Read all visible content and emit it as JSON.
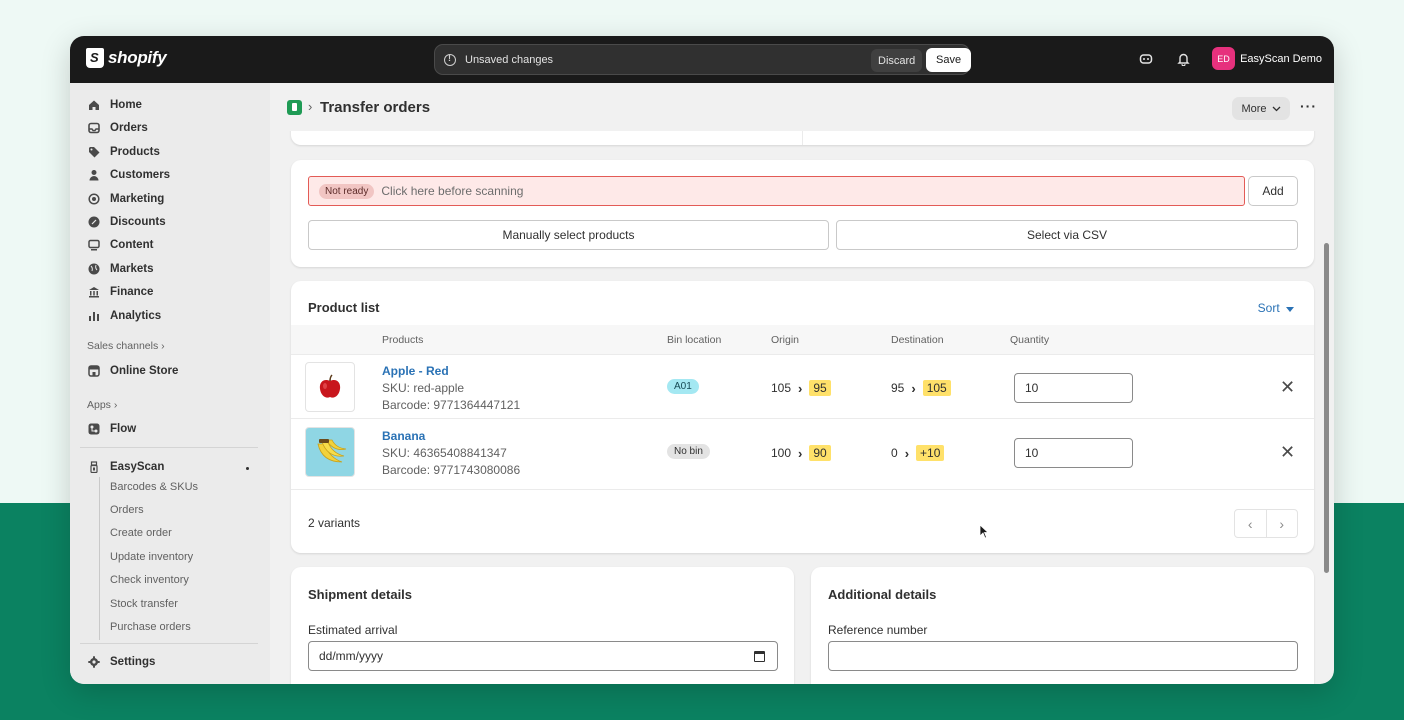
{
  "topbar": {
    "brand": "shopify",
    "unsaved_text": "Unsaved changes",
    "discard_label": "Discard",
    "save_label": "Save",
    "avatar_initials": "ED",
    "store_name": "EasyScan Demo"
  },
  "sidebar": {
    "items": [
      {
        "label": "Home",
        "icon": "home-icon"
      },
      {
        "label": "Orders",
        "icon": "orders-icon"
      },
      {
        "label": "Products",
        "icon": "tag-icon"
      },
      {
        "label": "Customers",
        "icon": "person-icon"
      },
      {
        "label": "Marketing",
        "icon": "target-icon"
      },
      {
        "label": "Discounts",
        "icon": "discount-icon"
      },
      {
        "label": "Content",
        "icon": "content-icon"
      },
      {
        "label": "Markets",
        "icon": "globe-icon"
      },
      {
        "label": "Finance",
        "icon": "bank-icon"
      },
      {
        "label": "Analytics",
        "icon": "bar-chart-icon"
      }
    ],
    "sales_channels_title": "Sales channels",
    "online_store": "Online Store",
    "apps_title": "Apps",
    "flow": "Flow",
    "easyscan": "EasyScan",
    "easyscan_subitems": [
      "Barcodes & SKUs",
      "Orders",
      "Create order",
      "Update inventory",
      "Check inventory",
      "Stock transfer",
      "Purchase orders"
    ],
    "settings": "Settings"
  },
  "header": {
    "title": "Transfer orders",
    "more_label": "More"
  },
  "scanner": {
    "status_badge": "Not ready",
    "placeholder": "Click here before scanning",
    "add_label": "Add",
    "manual_label": "Manually select products",
    "csv_label": "Select via CSV"
  },
  "product_list": {
    "title": "Product list",
    "sort_label": "Sort",
    "columns": [
      "Products",
      "Bin location",
      "Origin",
      "Destination",
      "Quantity"
    ],
    "rows": [
      {
        "name": "Apple - Red",
        "sku": "SKU: red-apple",
        "barcode": "Barcode: 9771364447121",
        "bin": "A01",
        "origin_from": "105",
        "origin_to": "95",
        "dest_from": "95",
        "dest_to": "105",
        "quantity": "10"
      },
      {
        "name": "Banana",
        "sku": "SKU: 46365408841347",
        "barcode": "Barcode: 9771743080086",
        "bin": "No bin",
        "origin_from": "100",
        "origin_to": "90",
        "dest_from": "0",
        "dest_to": "+10",
        "quantity": "10"
      }
    ],
    "variants_label": "2 variants"
  },
  "shipment": {
    "title": "Shipment details",
    "arrival_label": "Estimated arrival",
    "arrival_placeholder": "dd/mm/yyyy"
  },
  "additional": {
    "title": "Additional details",
    "reference_label": "Reference number",
    "reference_value": ""
  },
  "colors": {
    "accent_link": "#2a72b5",
    "error_border": "#e35b56",
    "highlight": "#ffe16a",
    "brand_green": "#0b8261"
  }
}
